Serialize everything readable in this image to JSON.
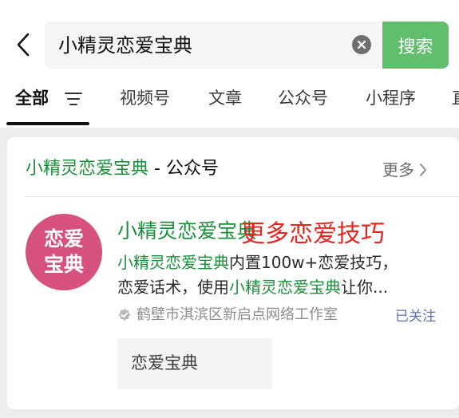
{
  "search": {
    "query": "小精灵恋爱宝典",
    "button_label": "搜索"
  },
  "tabs": [
    {
      "label": "全部",
      "active": true
    },
    {
      "label": "视频号"
    },
    {
      "label": "文章"
    },
    {
      "label": "公众号"
    },
    {
      "label": "小程序"
    },
    {
      "label": "直"
    }
  ],
  "section": {
    "title_name": "小精灵恋爱宝典",
    "title_suffix": " - 公众号",
    "more_label": "更多"
  },
  "account": {
    "avatar_line1": "恋爱",
    "avatar_line2": "宝典",
    "name": "小精灵恋爱宝典",
    "desc_hl1": "小精灵恋爱宝典",
    "desc_part1": "内置100w+恋爱技巧，",
    "desc_part2": "恋爱话术，使用",
    "desc_hl2": "小精灵恋爱宝典",
    "desc_part3": "让你...",
    "verified_by": "鹤壁市淇滨区新启点网络工作室",
    "follow_status": "已关注",
    "menu_item": "恋爱宝典"
  },
  "annotation": "更多恋爱技巧",
  "colors": {
    "brand_green": "#1a8f3a",
    "search_button": "#60be6d",
    "avatar_bg": "#d6517b",
    "annotation_red": "#e8241e",
    "link_blue": "#5a72a8"
  }
}
